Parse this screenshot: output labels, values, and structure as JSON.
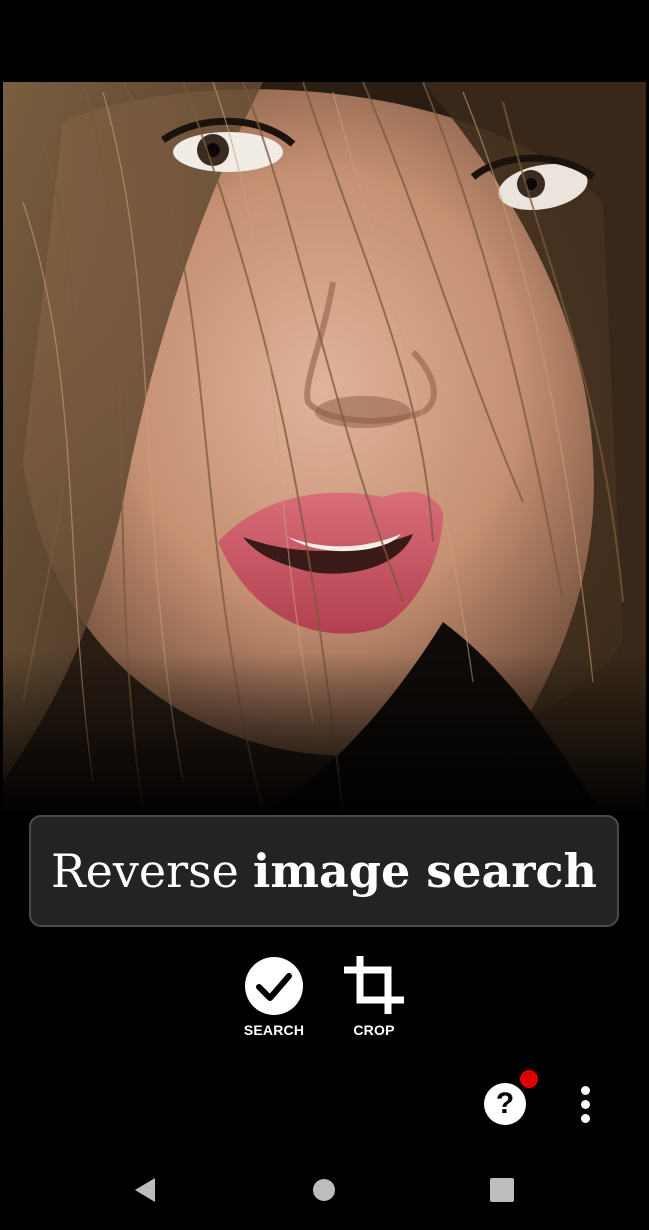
{
  "image_viewer": {
    "photo_icon": "portrait-photo",
    "title_regular": "Reverse",
    "title_bold": "image search"
  },
  "actions": {
    "search_label": "SEARCH",
    "search_icon": "check-circle-icon",
    "crop_label": "CROP",
    "crop_icon": "crop-icon"
  },
  "toolbar": {
    "help_glyph": "?",
    "help_badge_color": "#e00000",
    "more_icon": "more-vertical-icon"
  },
  "nav": {
    "back_icon": "back-triangle-icon",
    "home_icon": "home-circle-icon",
    "recent_icon": "recents-square-icon"
  },
  "colors": {
    "background": "#000000",
    "title_box": "#222323",
    "title_border": "#4a4a4a",
    "text": "#ffffff",
    "nav_icons": "#bdbdbd"
  }
}
